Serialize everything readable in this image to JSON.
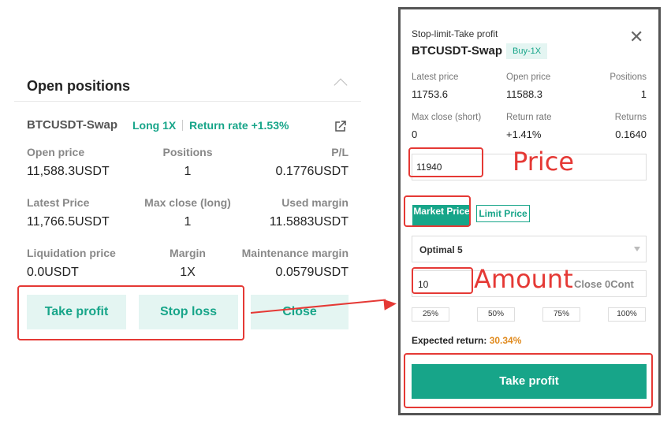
{
  "open_positions": {
    "title": "Open positions",
    "symbol": "BTCUSDT-Swap",
    "leverage": "Long 1X",
    "return_rate": "Return rate +1.53%",
    "rows": [
      [
        {
          "label": "Open price",
          "value": "11,588.3USDT"
        },
        {
          "label": "Positions",
          "value": "1"
        },
        {
          "label": "P/L",
          "value": "0.1776USDT"
        }
      ],
      [
        {
          "label": "Latest Price",
          "value": "11,766.5USDT"
        },
        {
          "label": "Max close (long)",
          "value": "1"
        },
        {
          "label": "Used margin",
          "value": "11.5883USDT"
        }
      ],
      [
        {
          "label": "Liquidation price",
          "value": "0.0USDT"
        },
        {
          "label": "Margin",
          "value": "1X"
        },
        {
          "label": "Maintenance margin",
          "value": "0.0579USDT"
        }
      ]
    ],
    "buttons": {
      "take_profit": "Take profit",
      "stop_loss": "Stop loss",
      "close": "Close"
    }
  },
  "dialog": {
    "subtitle": "Stop-limit-Take profit",
    "symbol": "BTCUSDT-Swap",
    "badge": "Buy-1X",
    "close_glyph": "✕",
    "rows": [
      [
        {
          "label": "Latest price",
          "value": "11753.6"
        },
        {
          "label": "Open price",
          "value": "11588.3"
        },
        {
          "label": "Positions",
          "value": "1"
        }
      ],
      [
        {
          "label": "Max close (short)",
          "value": "0"
        },
        {
          "label": "Return rate",
          "value": "+1.41%"
        },
        {
          "label": "Returns",
          "value": "0.1640"
        }
      ]
    ],
    "price_value": "11940",
    "market_price_label": "Market Price",
    "limit_price_label": "Limit Price",
    "optimal_label": "Optimal 5",
    "amount_value": "10",
    "close_cont": "Close 0Cont",
    "percent_options": [
      "25%",
      "50%",
      "75%",
      "100%"
    ],
    "expected_label": "Expected return:",
    "expected_value": "30.34%",
    "submit_label": "Take profit"
  },
  "annotations": {
    "price": "Price",
    "amount": "Amount"
  },
  "colors": {
    "accent": "#17a589",
    "highlight": "#e53935",
    "orange": "#e08a1e"
  },
  "icons": [
    "share-icon",
    "chevron-up-icon",
    "close-icon",
    "dropdown-triangle-icon"
  ]
}
